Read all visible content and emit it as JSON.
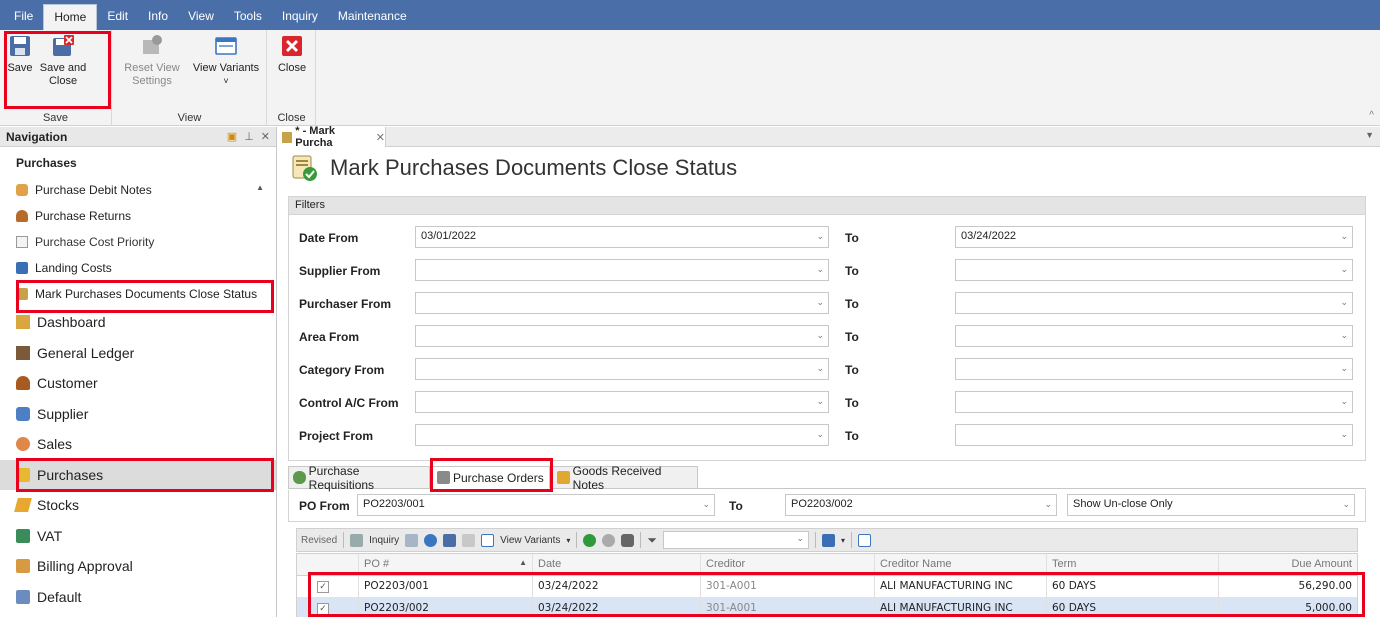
{
  "menu": [
    "File",
    "Home",
    "Edit",
    "Info",
    "View",
    "Tools",
    "Inquiry",
    "Maintenance"
  ],
  "ribbon": {
    "save_group": {
      "caption": "Save",
      "save": "Save",
      "save_close_1": "Save and",
      "save_close_2": "Close"
    },
    "view_group": {
      "caption": "View",
      "reset_1": "Reset View",
      "reset_2": "Settings",
      "variants": "View Variants",
      "variants_arrow": "˅"
    },
    "close_group": {
      "caption": "Close",
      "close": "Close"
    }
  },
  "navigation": {
    "title": "Navigation",
    "section": "Purchases",
    "subitems": [
      "Purchase Debit Notes",
      "Purchase Returns",
      "Purchase Cost Priority",
      "Landing Costs",
      "Mark Purchases Documents Close Status"
    ],
    "modules": [
      "Dashboard",
      "General Ledger",
      "Customer",
      "Supplier",
      "Sales",
      "Purchases",
      "Stocks",
      "VAT",
      "Billing Approval",
      "Default"
    ]
  },
  "doc_tab": {
    "label": "* - Mark Purcha"
  },
  "page_title": "Mark Purchases Documents Close Status",
  "filters": {
    "header": "Filters",
    "to_label": "To",
    "rows": [
      {
        "label": "Date From",
        "from": "03/01/2022",
        "to": "03/24/2022"
      },
      {
        "label": "Supplier From",
        "from": "",
        "to": ""
      },
      {
        "label": "Purchaser From",
        "from": "",
        "to": ""
      },
      {
        "label": "Area From",
        "from": "",
        "to": ""
      },
      {
        "label": "Category From",
        "from": "",
        "to": ""
      },
      {
        "label": "Control A/C From",
        "from": "",
        "to": ""
      },
      {
        "label": "Project From",
        "from": "",
        "to": ""
      }
    ]
  },
  "inner_tabs": [
    "Purchase Requisitions",
    "Purchase Orders",
    "Goods Received Notes"
  ],
  "po_filter": {
    "label": "PO From",
    "from": "PO2203/001",
    "to_label": "To",
    "to": "PO2203/002",
    "show": "Show Un-close Only"
  },
  "toolbar": {
    "revised": "Revised",
    "inquiry": "Inquiry",
    "view_variants": "View Variants"
  },
  "grid": {
    "columns": [
      "PO #",
      "Date",
      "Creditor",
      "Creditor Name",
      "Term",
      "Due Amount"
    ],
    "rows": [
      {
        "po": "PO2203/001",
        "date": "03/24/2022",
        "creditor": "301-A001",
        "name": "ALI MANUFACTURING INC",
        "term": "60 DAYS",
        "amount": "56,290.00",
        "checked": true
      },
      {
        "po": "PO2203/002",
        "date": "03/24/2022",
        "creditor": "301-A001",
        "name": "ALI MANUFACTURING INC",
        "term": "60 DAYS",
        "amount": "5,000.00",
        "checked": true
      }
    ]
  },
  "colors": {
    "menubar": "#4a6ea8",
    "highlight": "#e8001c",
    "selected_row": "#d9e4f5"
  }
}
